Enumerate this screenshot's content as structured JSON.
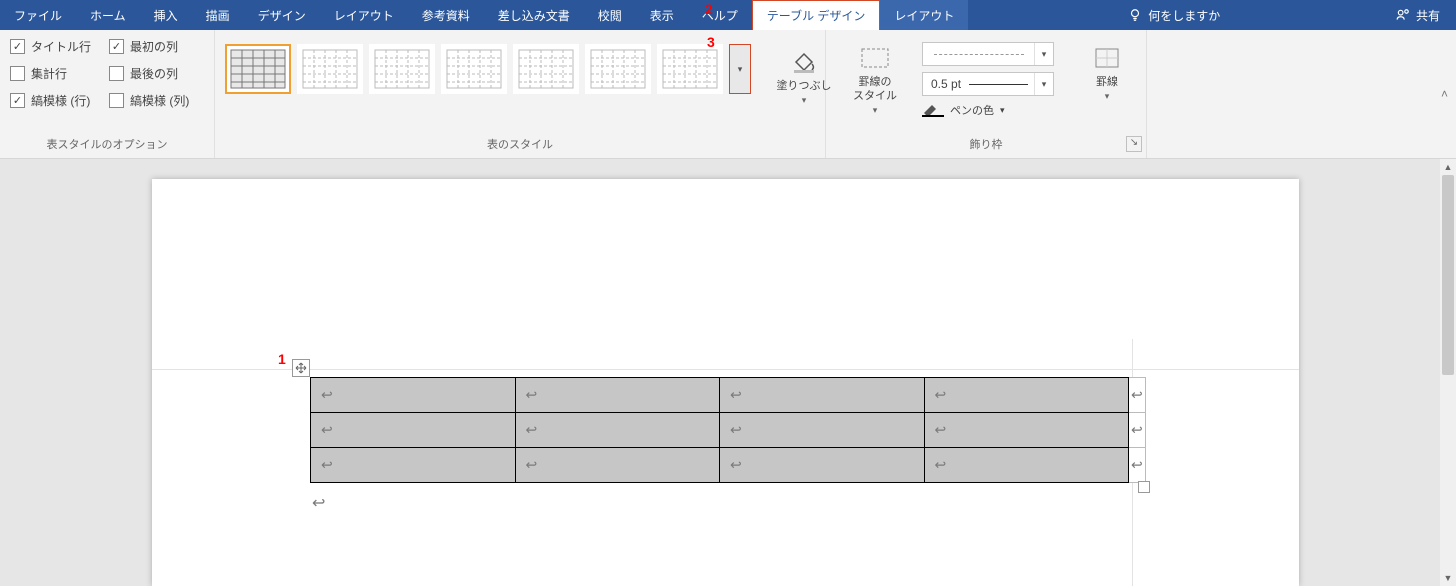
{
  "menu": {
    "file": "ファイル",
    "home": "ホーム",
    "insert": "挿入",
    "draw": "描画",
    "design": "デザイン",
    "layout": "レイアウト",
    "references": "参考資料",
    "mailings": "差し込み文書",
    "review": "校閲",
    "view": "表示",
    "help": "ヘルプ",
    "table_design": "テーブル デザイン",
    "table_layout": "レイアウト",
    "search_placeholder": "何をしますか",
    "share": "共有"
  },
  "ribbon": {
    "options_group_label": "表スタイルのオプション",
    "styles_group_label": "表のスタイル",
    "borders_group_label": "飾り枠",
    "opt_header_row": "タイトル行",
    "opt_total_row": "集計行",
    "opt_banded_rows": "縞模様 (行)",
    "opt_first_col": "最初の列",
    "opt_last_col": "最後の列",
    "opt_banded_cols": "縞模様 (列)",
    "shading": "塗りつぶし",
    "border_styles": "罫線の\nスタイル",
    "border_width": "0.5 pt",
    "pen_color": "ペンの色",
    "borders_btn": "罫線",
    "checked": {
      "header_row": true,
      "total_row": false,
      "banded_rows": true,
      "first_col": true,
      "last_col": false,
      "banded_cols": false
    }
  },
  "annotations": {
    "a1": "1",
    "a2": "2",
    "a3": "3"
  },
  "doc": {
    "cell_mark": "↩",
    "para_mark": "↩"
  }
}
